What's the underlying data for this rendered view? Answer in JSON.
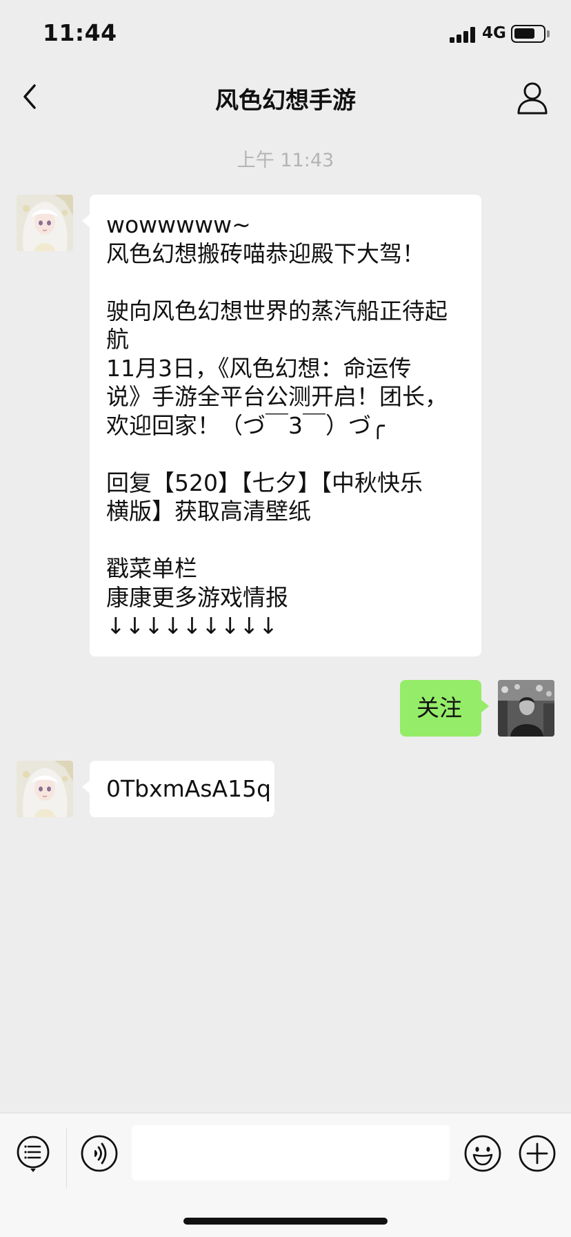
{
  "status_bar": {
    "time": "11:44",
    "network": "4G",
    "battery_level": 0.75
  },
  "nav": {
    "title": "风色幻想手游",
    "back_icon": "chevron-left-icon",
    "profile_icon": "person-icon"
  },
  "chat": {
    "timestamp": "上午 11:43",
    "messages": [
      {
        "sender": "official-account",
        "lines": [
          "wowwwww~",
          "风色幻想搬砖喵恭迎殿下大驾！",
          "",
          "驶向风色幻想世界的蒸汽船正待起",
          "航",
          "11月3日，《风色幻想：命运传",
          "说》手游全平台公测开启！团长，",
          "欢迎回家！（づ￣3￣）づ╭",
          "",
          "回复【520】【七夕】【中秋快乐",
          "横版】获取高清壁纸",
          "",
          "戳菜单栏",
          "康康更多游戏情报",
          "↓↓↓↓↓↓↓↓↓"
        ]
      },
      {
        "sender": "me",
        "lines": [
          "关注"
        ]
      },
      {
        "sender": "official-account",
        "lines": [
          "0TbxmAsA15q"
        ]
      }
    ]
  },
  "input_bar": {
    "placeholder": "",
    "menu_icon": "menu-list-icon",
    "voice_icon": "voice-icon",
    "emoji_icon": "emoji-icon",
    "plus_icon": "plus-icon"
  },
  "colors": {
    "background": "#ededed",
    "incoming_bubble": "#ffffff",
    "outgoing_bubble": "#95ec69",
    "timestamp": "#b4b4b4"
  }
}
